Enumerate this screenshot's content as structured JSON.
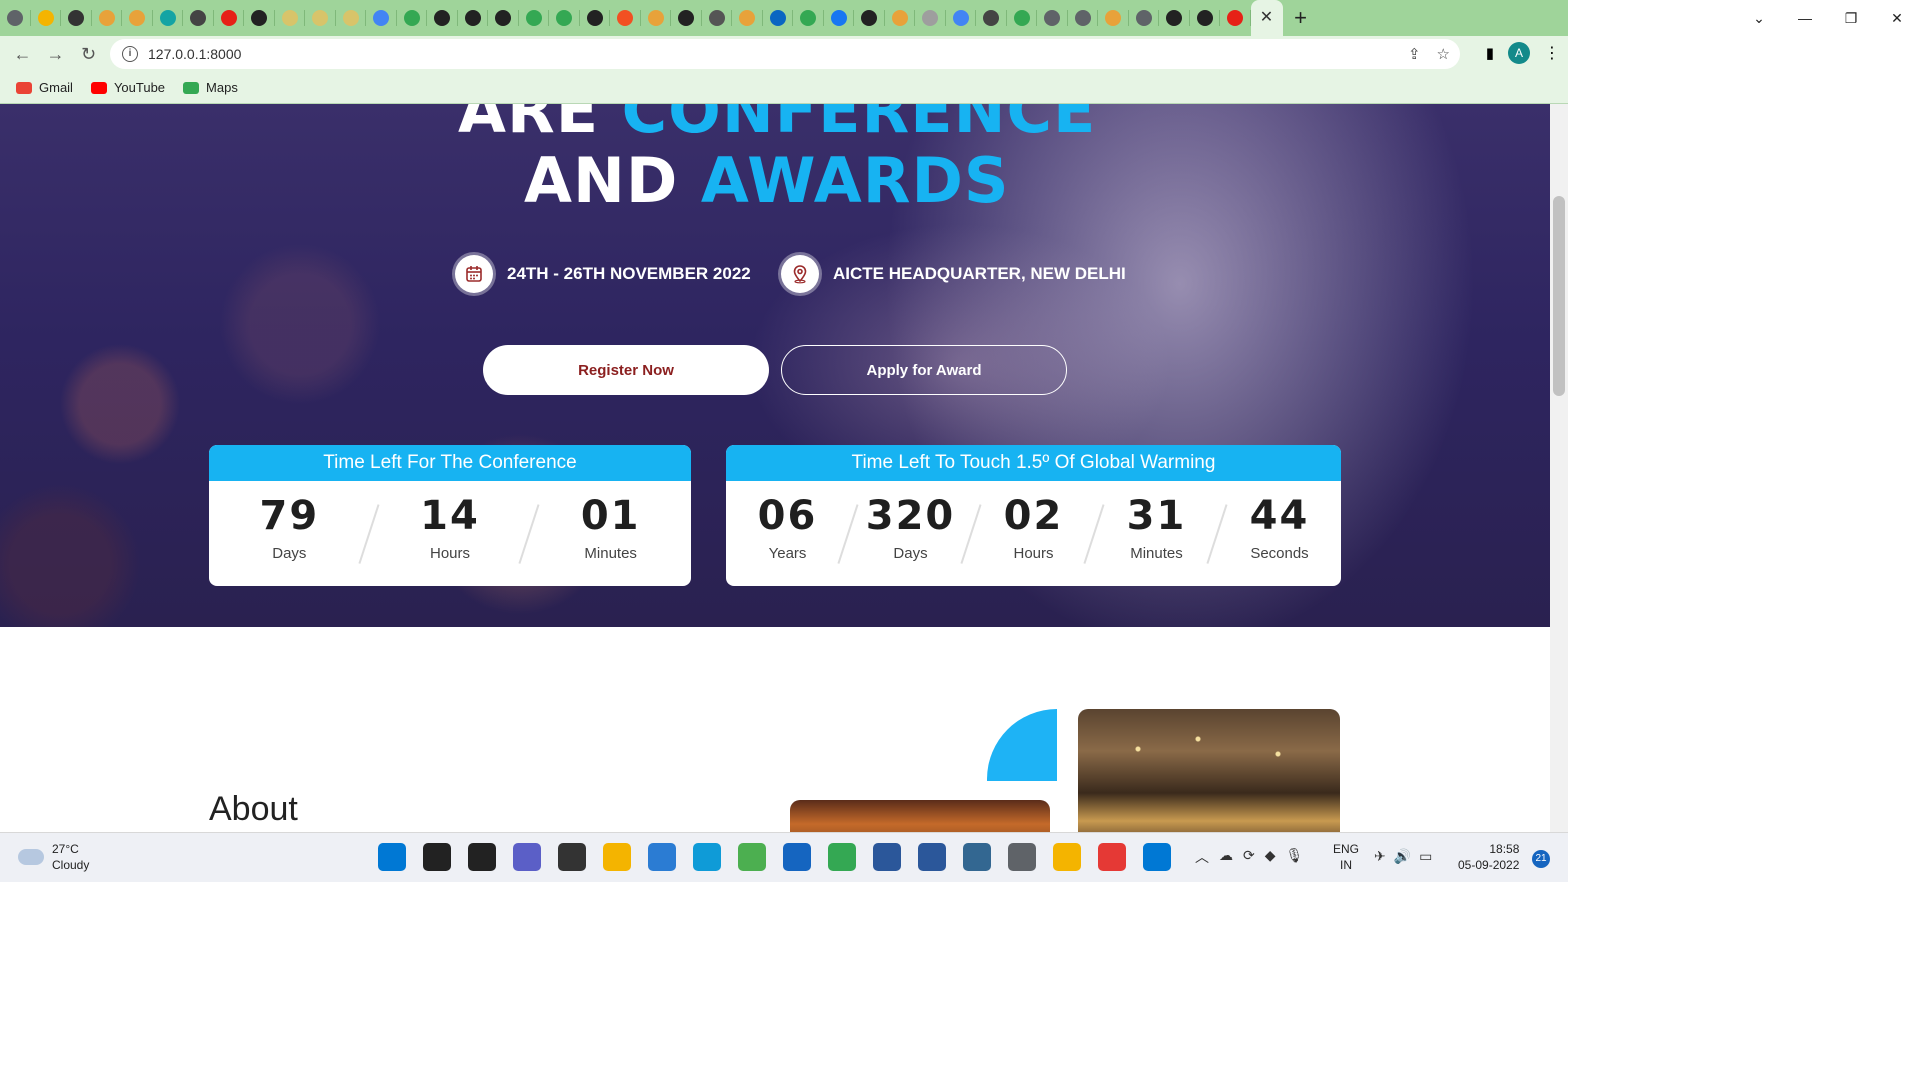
{
  "browser": {
    "tab_favicon_colors": [
      "#5f6368",
      "#f4b400",
      "#333333",
      "#e8a23a",
      "#e8a23a",
      "#14a4a4",
      "#444444",
      "#e62117",
      "#222222",
      "#d8c46a",
      "#d8c46a",
      "#d8c46a",
      "#4285f4",
      "#34a853",
      "#222222",
      "#222222",
      "#222222",
      "#34a853",
      "#34a853",
      "#222222",
      "#f25022",
      "#e8a23a",
      "#222222",
      "#555555",
      "#e8a23a",
      "#0a66c2",
      "#34a853",
      "#1877f2",
      "#222222",
      "#e8a23a",
      "#9e9e9e",
      "#4285f4",
      "#444444",
      "#34a853",
      "#5f6368",
      "#5f6368",
      "#e8a23a",
      "#5f6368",
      "#222222",
      "#222222",
      "#e62117"
    ],
    "active_tab_close": "✕",
    "new_tab": "+",
    "url": "127.0.0.1:8000",
    "profile_initial": "A",
    "bookmarks": [
      {
        "label": "Gmail",
        "color": "#ea4335"
      },
      {
        "label": "YouTube",
        "color": "#ff0000"
      },
      {
        "label": "Maps",
        "color": "#34a853"
      }
    ]
  },
  "hero": {
    "headline_partial_white": "ARE ",
    "headline_partial_accent": "CONFERENCE",
    "headline_white": "AND ",
    "headline_accent": "AWARDS",
    "date": "24TH - 26TH NOVEMBER 2022",
    "location": "AICTE HEADQUARTER, NEW DELHI",
    "register_label": "Register Now",
    "apply_label": "Apply for Award",
    "accent_color": "#17b3f2"
  },
  "countdown_conference": {
    "title": "Time Left For The Conference",
    "units": [
      {
        "value": "79",
        "label": "Days"
      },
      {
        "value": "14",
        "label": "Hours"
      },
      {
        "value": "01",
        "label": "Minutes"
      }
    ]
  },
  "countdown_warming": {
    "title": "Time Left To Touch 1.5º Of Global Warming",
    "units": [
      {
        "value": "06",
        "label": "Years"
      },
      {
        "value": "320",
        "label": "Days"
      },
      {
        "value": "02",
        "label": "Hours"
      },
      {
        "value": "31",
        "label": "Minutes"
      },
      {
        "value": "44",
        "label": "Seconds"
      }
    ]
  },
  "about": {
    "title": "About"
  },
  "taskbar": {
    "temperature": "27°C",
    "condition": "Cloudy",
    "lang_top": "ENG",
    "lang_bottom": "IN",
    "time": "18:58",
    "date": "05-09-2022",
    "notifications": "21",
    "app_colors": [
      "#0078d4",
      "#222222",
      "#222222",
      "#5b5fc7",
      "#333333",
      "#f4b400",
      "#2b7cd3",
      "#0f9bd7",
      "#4caf50",
      "#1565c0",
      "#34a853",
      "#2b579a",
      "#2b579a",
      "#336791",
      "#5f6368",
      "#f4b400",
      "#e53935",
      "#0078d4"
    ]
  }
}
